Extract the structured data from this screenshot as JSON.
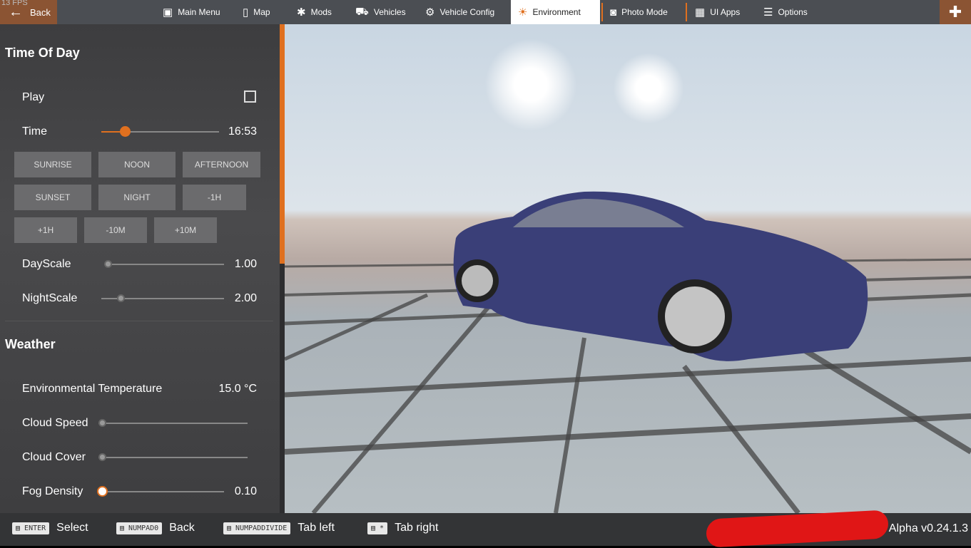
{
  "topbar": {
    "fps": "13 FPS",
    "back": "Back",
    "tabs": [
      {
        "label": "Main Menu",
        "icon": "main-menu-icon",
        "glyph": "▣"
      },
      {
        "label": "Map",
        "icon": "map-icon",
        "glyph": "▯"
      },
      {
        "label": "Mods",
        "icon": "puzzle-icon",
        "glyph": "✱"
      },
      {
        "label": "Vehicles",
        "icon": "car-icon",
        "glyph": "⛟"
      },
      {
        "label": "Vehicle Config",
        "icon": "engine-icon",
        "glyph": "⚙"
      },
      {
        "label": "Environment",
        "icon": "weather-icon",
        "glyph": "☀"
      },
      {
        "label": "Photo Mode",
        "icon": "camera-icon",
        "glyph": "◙"
      },
      {
        "label": "UI Apps",
        "icon": "ui-apps-icon",
        "glyph": "▦"
      },
      {
        "label": "Options",
        "icon": "sliders-icon",
        "glyph": "☰"
      }
    ],
    "active_tab": "Environment",
    "plus": "✚"
  },
  "panel": {
    "time_of_day": {
      "title": "Time Of Day",
      "play": "Play",
      "play_checked": false,
      "time_label": "Time",
      "time_value": "16:53",
      "time_fraction": 0.2,
      "buttons": [
        "SUNRISE",
        "NOON",
        "AFTERNOON",
        "SUNSET",
        "NIGHT",
        "-1H",
        "+1H",
        "-10M",
        "+10M"
      ],
      "dayscale_label": "DayScale",
      "dayscale_value": "1.00",
      "dayscale_fraction": 0.05,
      "nightscale_label": "NightScale",
      "nightscale_value": "2.00",
      "nightscale_fraction": 0.16
    },
    "weather": {
      "title": "Weather",
      "temp_label": "Environmental Temperature",
      "temp_value": "15.0 °C",
      "cloud_speed_label": "Cloud Speed",
      "cloud_speed_fraction": 0,
      "cloud_cover_label": "Cloud Cover",
      "cloud_cover_fraction": 0,
      "fog_label": "Fog Density",
      "fog_value": "0.10",
      "fog_fraction": 0
    }
  },
  "bottombar": {
    "hints": [
      {
        "key": "ENTER",
        "action": "Select"
      },
      {
        "key": "NUMPAD0",
        "action": "Back"
      },
      {
        "key": "NUMPADDIVIDE",
        "action": "Tab left"
      },
      {
        "key": "*",
        "action": "Tab right"
      }
    ],
    "version": "Alpha v0.24.1.3"
  },
  "colors": {
    "accent": "#e0701f",
    "back_bg": "#8b5433"
  }
}
